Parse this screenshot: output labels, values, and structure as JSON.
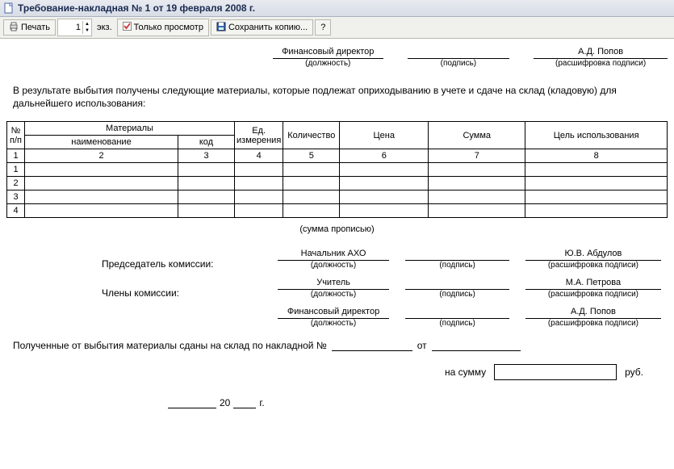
{
  "window": {
    "title": "Требование-накладная № 1 от 19 февраля 2008 г."
  },
  "toolbar": {
    "print": "Печать",
    "copies_value": "1",
    "copies_unit": "экз.",
    "view_only": "Только просмотр",
    "save_copy": "Сохранить копию...",
    "help": "?"
  },
  "top_sign": {
    "position_value": "Финансовый директор",
    "position_caption": "(должность)",
    "sign_caption": "(подпись)",
    "name_value": "А.Д. Попов",
    "name_caption": "(расшифровка подписи)"
  },
  "paragraph": "В результате выбытия получены следующие материалы, которые подлежат оприходыванию в учете и сдаче на склад (кладовую) для дальнейшего использования:",
  "table": {
    "headers": {
      "np": "№ п/п",
      "materials": "Материалы",
      "name": "наименование",
      "code": "код",
      "unit": "Ед. измерения",
      "qty": "Количество",
      "price": "Цена",
      "sum": "Сумма",
      "purpose": "Цель использования"
    },
    "numrow": [
      "1",
      "2",
      "3",
      "4",
      "5",
      "6",
      "7",
      "8"
    ],
    "rows": [
      "1",
      "2",
      "3",
      "4"
    ]
  },
  "sum_words_caption": "(сумма прописью)",
  "commission": {
    "chair_label": "Председатель комиссии:",
    "members_label": "Члены комиссии:",
    "rows": [
      {
        "position": "Начальник АХО",
        "name": "Ю.В. Абдулов"
      },
      {
        "position": "Учитель",
        "name": "М.А. Петрова"
      },
      {
        "position": "Финансовый директор",
        "name": "А.Д. Попов"
      }
    ],
    "position_caption": "(должность)",
    "sign_caption": "(подпись)",
    "name_caption": "(расшифровка подписи)"
  },
  "footer": {
    "text1": "Полученные от выбытия материалы сданы на склад по накладной №",
    "text_ot": "от",
    "amount_label": "на сумму",
    "rub": "руб.",
    "year_prefix": "20",
    "year_suffix": "г."
  }
}
